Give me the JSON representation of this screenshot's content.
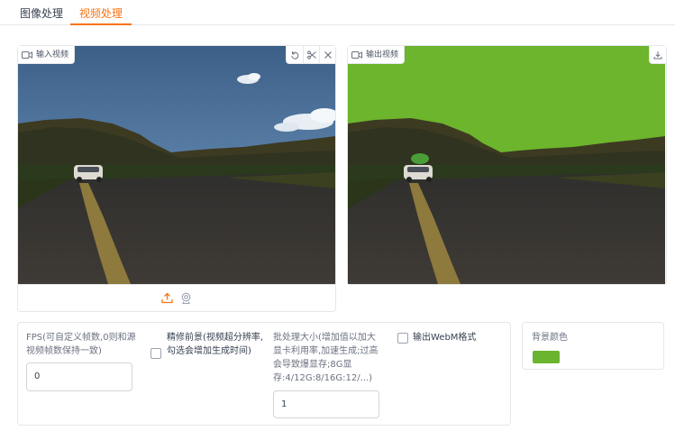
{
  "tabs": [
    {
      "label": "图像处理",
      "active": false
    },
    {
      "label": "视频处理",
      "active": true
    }
  ],
  "input_video": {
    "label": "输入视频",
    "tools": [
      "undo-icon",
      "scissors-icon",
      "close-icon"
    ],
    "footer_icons": [
      "upload-icon",
      "webcam-icon"
    ]
  },
  "output_video": {
    "label": "输出视频",
    "tools": [
      "download-icon"
    ]
  },
  "settings": {
    "fps": {
      "label": "FPS(可自定义帧数,0则和源视频帧数保持一致)",
      "value": "0"
    },
    "refine": {
      "label": "精修前景(视频超分辨率,勾选会增加生成时间)",
      "checked": false
    },
    "batch": {
      "label": "批处理大小(增加值以加大显卡利用率,加速生成;过高会导致爆显存;8G显存:4/12G:8/16G:12/...)",
      "value": "1"
    },
    "webm": {
      "label": "输出WebM格式",
      "checked": false
    }
  },
  "background_color": {
    "label": "背景颜色",
    "color": "#6ab42f"
  },
  "colors": {
    "accent": "#f97316",
    "greenscreen": "#6cb52c"
  }
}
